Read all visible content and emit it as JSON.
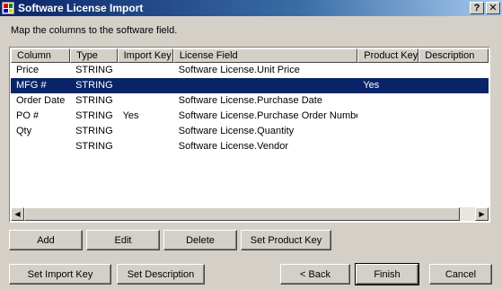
{
  "window": {
    "title": "Software License Import",
    "help_label": "?",
    "close_label": "✕"
  },
  "instruction": "Map the columns to the software field.",
  "columns": [
    "Column",
    "Type",
    "Import Key",
    "License Field",
    "Product Key",
    "Description"
  ],
  "rows": [
    {
      "cells": [
        "Price",
        "STRING",
        "",
        "Software License.Unit Price",
        "",
        ""
      ],
      "selected": false
    },
    {
      "cells": [
        "MFG #",
        "STRING",
        "",
        "",
        "Yes",
        ""
      ],
      "selected": true
    },
    {
      "cells": [
        "Order Date",
        "STRING",
        "",
        "Software License.Purchase Date",
        "",
        ""
      ],
      "selected": false
    },
    {
      "cells": [
        "PO #",
        "STRING",
        "Yes",
        "Software License.Purchase Order Number",
        "",
        ""
      ],
      "selected": false
    },
    {
      "cells": [
        "Qty",
        "STRING",
        "",
        "Software License.Quantity",
        "",
        ""
      ],
      "selected": false
    },
    {
      "cells": [
        "",
        "STRING",
        "",
        "Software License.Vendor",
        "",
        ""
      ],
      "selected": false
    }
  ],
  "scrollbar": {
    "left_icon": "◀",
    "right_icon": "▶"
  },
  "buttons": {
    "add": "Add",
    "edit": "Edit",
    "delete": "Delete",
    "set_product_key": "Set Product Key",
    "set_import_key": "Set Import Key",
    "set_description": "Set Description",
    "back": "< Back",
    "finish": "Finish",
    "cancel": "Cancel"
  }
}
